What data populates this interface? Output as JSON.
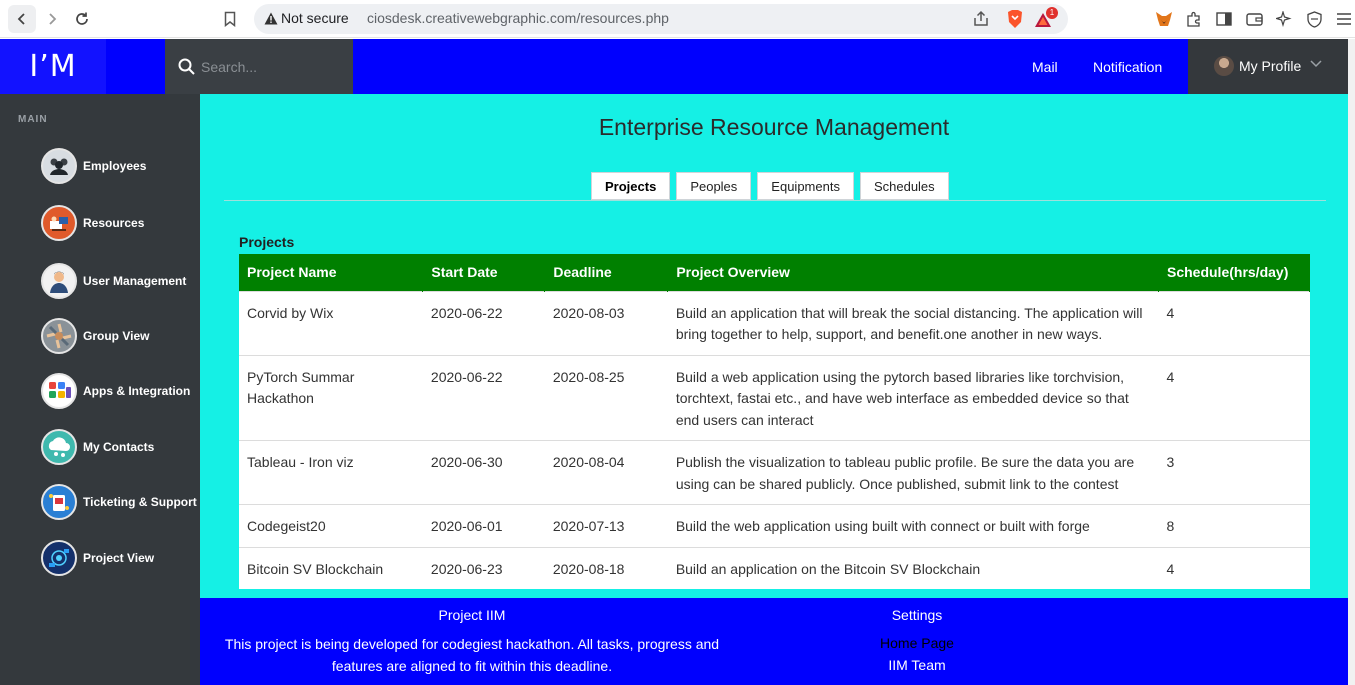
{
  "browser": {
    "security_label": "Not secure",
    "url": "ciosdesk.creativewebgraphic.com/resources.php",
    "notification_count": "1"
  },
  "header": {
    "logo": "I’M",
    "search_placeholder": "Search...",
    "mail": "Mail",
    "notification": "Notification",
    "profile": "My Profile"
  },
  "sidebar": {
    "section": "MAIN",
    "items": [
      {
        "label": "Employees",
        "icon": "employees-icon"
      },
      {
        "label": "Resources",
        "icon": "resources-icon"
      },
      {
        "label": "User Management",
        "icon": "user-management-icon"
      },
      {
        "label": "Group View",
        "icon": "group-view-icon"
      },
      {
        "label": "Apps & Integration",
        "icon": "apps-integration-icon"
      },
      {
        "label": "My Contacts",
        "icon": "contacts-icon"
      },
      {
        "label": "Ticketing & Support",
        "icon": "ticketing-icon"
      },
      {
        "label": "Project View",
        "icon": "project-view-icon"
      }
    ]
  },
  "main": {
    "title": "Enterprise Resource Management",
    "tabs": [
      {
        "label": "Projects",
        "active": true
      },
      {
        "label": "Peoples",
        "active": false
      },
      {
        "label": "Equipments",
        "active": false
      },
      {
        "label": "Schedules",
        "active": false
      }
    ],
    "caption": "Projects",
    "columns": [
      "Project Name",
      "Start Date",
      "Deadline",
      "Project Overview",
      "Schedule(hrs/day)"
    ],
    "rows": [
      {
        "name": "Corvid by Wix",
        "start": "2020-06-22",
        "deadline": "2020-08-03",
        "overview": "Build an application that will break the social distancing. The application will bring together to help, support, and benefit.one another in new ways.",
        "schedule": "4"
      },
      {
        "name": "PyTorch Summar Hackathon",
        "start": "2020-06-22",
        "deadline": "2020-08-25",
        "overview": "Build a web application using the pytorch based libraries like torchvision, torchtext, fastai etc., and have web interface as embedded device so that end users can interact",
        "schedule": "4"
      },
      {
        "name": "Tableau - Iron viz",
        "start": "2020-06-30",
        "deadline": "2020-08-04",
        "overview": "Publish the visualization to tableau public profile. Be sure the data you are using can be shared publicly. Once published, submit link to the contest",
        "schedule": "3"
      },
      {
        "name": "Codegeist20",
        "start": "2020-06-01",
        "deadline": "2020-07-13",
        "overview": "Build the web application using built with connect or built with forge",
        "schedule": "8"
      },
      {
        "name": "Bitcoin SV Blockchain",
        "start": "2020-06-23",
        "deadline": "2020-08-18",
        "overview": "Build an application on the Bitcoin SV Blockchain",
        "schedule": "4"
      }
    ]
  },
  "footer": {
    "title": "Project IIM",
    "description": "This project is being developed for codegiest hackathon. All tasks, progress and features are aligned to fit within this deadline.",
    "settings_title": "Settings",
    "home_link": "Home Page",
    "team_link": "IIM Team"
  },
  "colors": {
    "header_bg": "#0000fe",
    "sidebar_bg": "#34393d",
    "content_bg": "#15f0e5",
    "table_header": "#008000"
  }
}
